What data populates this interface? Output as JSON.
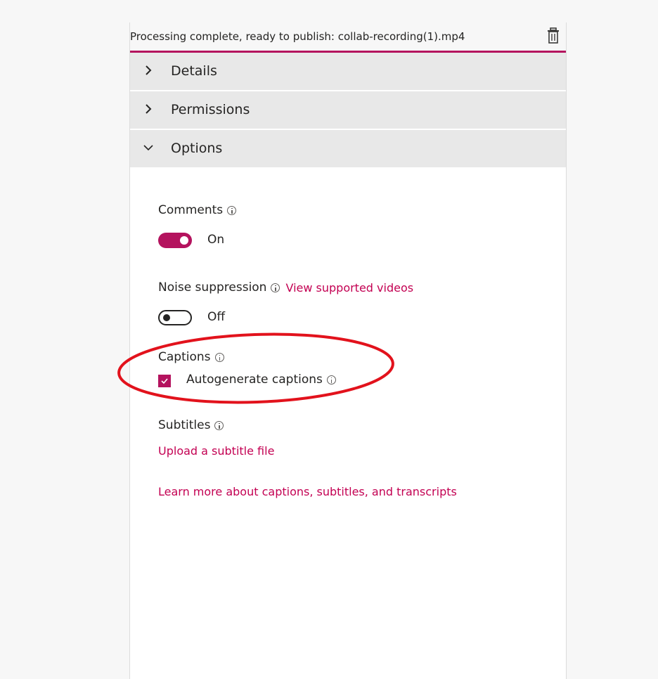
{
  "header": {
    "status": "Processing complete, ready to publish: collab-recording(1).mp4",
    "delete_icon": "trash-icon"
  },
  "sections": [
    {
      "label": "Details",
      "expanded": false,
      "icon": "chevron-right-icon"
    },
    {
      "label": "Permissions",
      "expanded": false,
      "icon": "chevron-right-icon"
    },
    {
      "label": "Options",
      "expanded": true,
      "icon": "chevron-down-icon"
    }
  ],
  "options": {
    "comments": {
      "label": "Comments",
      "state": "On",
      "on": true
    },
    "noise": {
      "label": "Noise suppression",
      "link": "View supported videos",
      "state": "Off",
      "on": false
    },
    "captions": {
      "label": "Captions",
      "checkbox_label": "Autogenerate captions",
      "checked": true
    },
    "subtitles": {
      "label": "Subtitles",
      "upload_link": "Upload a subtitle file"
    },
    "learn_more": "Learn more about captions, subtitles, and transcripts"
  },
  "colors": {
    "accent": "#b4135e",
    "link": "#c30052",
    "annotation": "#e2121c"
  }
}
